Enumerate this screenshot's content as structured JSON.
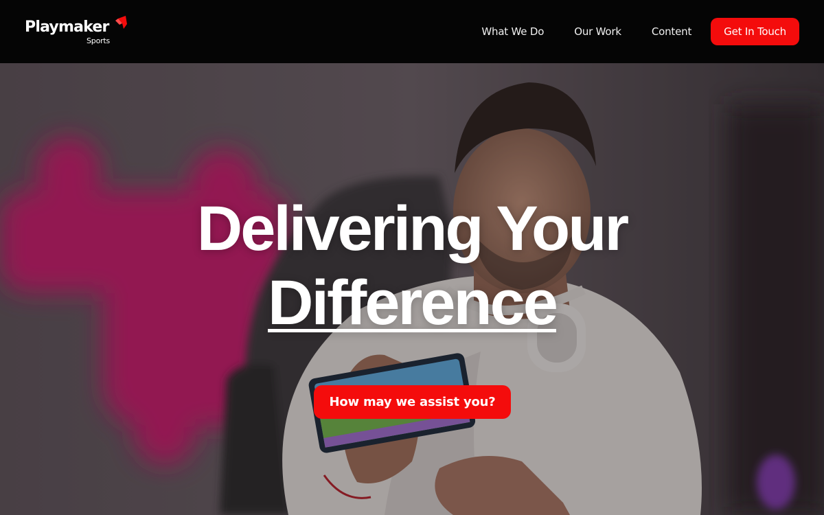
{
  "brand": {
    "name": "Playmaker",
    "sub": "Sports",
    "accent_color": "#f40c0c"
  },
  "nav": {
    "links": [
      {
        "label": "What We Do"
      },
      {
        "label": "Our Work"
      },
      {
        "label": "Content"
      }
    ],
    "cta_label": "Get In Touch"
  },
  "hero": {
    "headline_line1": "Delivering Your",
    "headline_line2": "Difference",
    "button_label": "How may we assist you?"
  }
}
